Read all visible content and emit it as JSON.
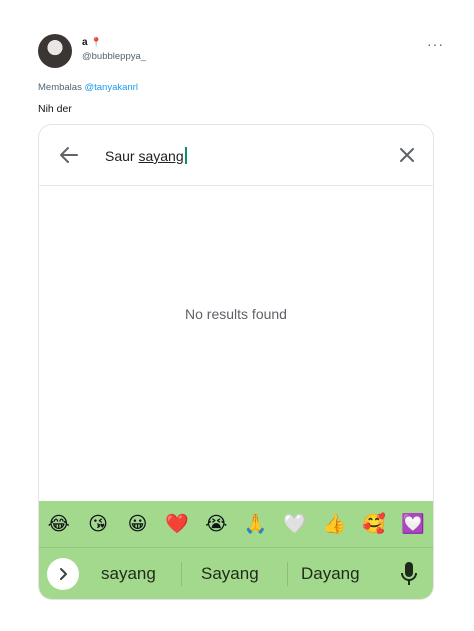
{
  "tweet": {
    "display_name": "a",
    "name_emoji": "📍",
    "handle": "@bubbleppya_",
    "more": "···",
    "reply_prefix": "Membalas",
    "reply_mention": "@tanyakanrl",
    "text": "Nih der"
  },
  "search": {
    "query_prefix": "Saur ",
    "query_typed": "sayang",
    "no_results": "No results found"
  },
  "emojis": [
    {
      "char": "😂",
      "name": "face-tears-joy-icon"
    },
    {
      "char": "😘",
      "name": "face-blowing-kiss-icon"
    },
    {
      "char": "😀",
      "name": "grinning-face-icon"
    },
    {
      "char": "❤️",
      "name": "red-heart-icon"
    },
    {
      "char": "😭",
      "name": "loudly-crying-face-icon"
    },
    {
      "char": "🙏",
      "name": "folded-hands-icon"
    },
    {
      "char": "🤍",
      "name": "white-heart-icon"
    },
    {
      "char": "👍",
      "name": "thumbs-up-icon"
    },
    {
      "char": "🥰",
      "name": "smiling-hearts-face-icon"
    },
    {
      "char": "💟",
      "name": "heart-decoration-icon"
    }
  ],
  "suggestions": [
    "sayang",
    "Sayang",
    "Dayang"
  ],
  "colors": {
    "keyboard_bg": "#a3d98c",
    "mention": "#1d9bf0",
    "cursor": "#0b8f6f"
  }
}
